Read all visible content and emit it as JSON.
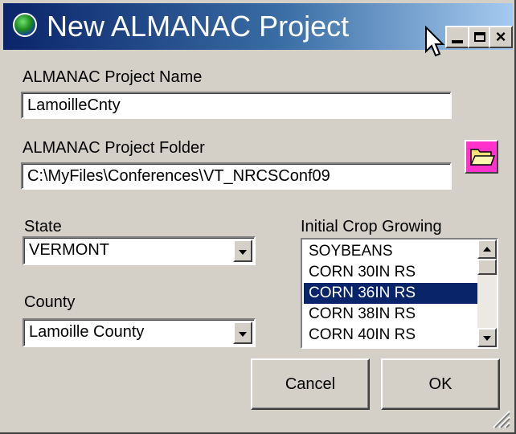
{
  "window": {
    "title": "New ALMANAC Project",
    "controls": {
      "minimize": "_",
      "maximize": "□",
      "close": "×"
    }
  },
  "project_name": {
    "label": "ALMANAC Project Name",
    "value": "LamoilleCnty"
  },
  "project_folder": {
    "label": "ALMANAC Project Folder",
    "value": "C:\\MyFiles\\Conferences\\VT_NRCSConf09",
    "browse_icon": "folder-open-icon"
  },
  "state": {
    "label": "State",
    "selected": "VERMONT"
  },
  "county": {
    "label": "County",
    "selected": "Lamoille County"
  },
  "crop": {
    "label": "Initial Crop Growing",
    "items": [
      "SOYBEANS",
      "CORN 30IN RS",
      "CORN 36IN RS",
      "CORN 38IN RS",
      "CORN 40IN RS"
    ],
    "selected": "CORN 36IN RS"
  },
  "buttons": {
    "cancel": "Cancel",
    "ok": "OK"
  },
  "colors": {
    "title_start": "#0a246a",
    "title_end": "#a6caf0",
    "selection": "#0a246a",
    "face": "#d4d0c8",
    "folder_button": "#ff33cc"
  }
}
